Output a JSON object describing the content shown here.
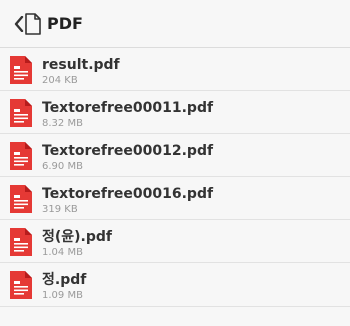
{
  "header": {
    "title": "PDF",
    "back_icon": "chevron-left-icon",
    "folder_icon": "document-outline-icon"
  },
  "colors": {
    "pdf_icon": "#e53935",
    "pdf_icon_fold": "#b71c1c"
  },
  "files": [
    {
      "name": "result.pdf",
      "size": "204 KB"
    },
    {
      "name": "Textorefree00011.pdf",
      "size": "8.32 MB"
    },
    {
      "name": "Textorefree00012.pdf",
      "size": "6.90 MB"
    },
    {
      "name": "Textorefree00016.pdf",
      "size": "319 KB"
    },
    {
      "name": "정(윤).pdf",
      "size": "1.04 MB"
    },
    {
      "name": "정.pdf",
      "size": "1.09 MB"
    }
  ]
}
